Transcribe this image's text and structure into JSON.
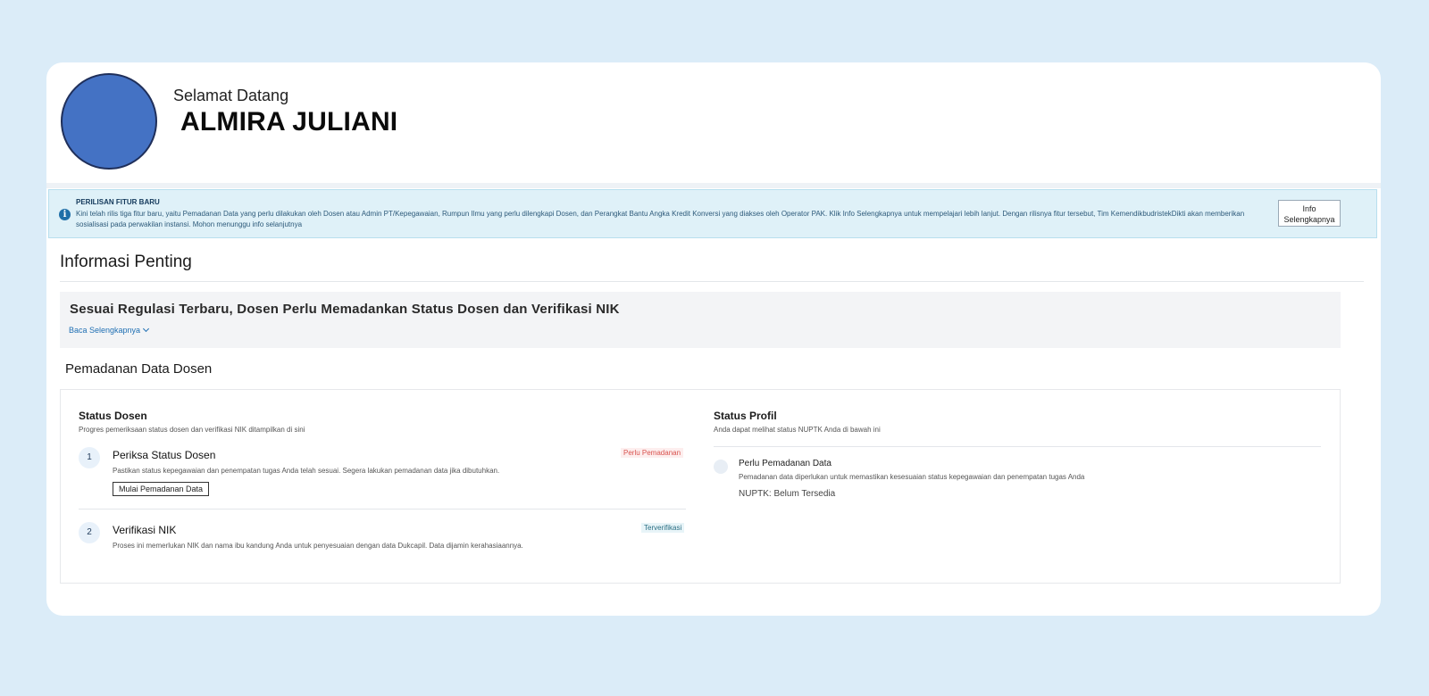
{
  "welcome": {
    "greeting": "Selamat Datang",
    "name": "ALMIRA JULIANI"
  },
  "notice": {
    "title": "PERILISAN FITUR BARU",
    "body": "Kini telah rilis tiga fitur baru, yaitu Pemadanan Data yang perlu dilakukan oleh Dosen atau Admin PT/Kepegawaian, Rumpun Ilmu yang perlu dilengkapi Dosen, dan Perangkat Bantu Angka Kredit Konversi yang diakses oleh Operator PAK. Klik Info Selengkapnya untuk mempelajari lebih lanjut. Dengan rilisnya fitur tersebut, Tim KemendikbudristekDikti akan memberikan sosialisasi pada perwakilan instansi. Mohon menunggu info selanjutnya",
    "button_label": "Info Selengkapnya"
  },
  "important": {
    "title": "Informasi Penting",
    "regulation_title": "Sesuai Regulasi Terbaru, Dosen Perlu Memadankan Status Dosen dan Verifikasi NIK",
    "read_more": "Baca Selengkapnya"
  },
  "matching": {
    "title": "Pemadanan Data Dosen",
    "status_dosen": {
      "title": "Status Dosen",
      "desc": "Progres pemeriksaan status dosen dan verifikasi NIK ditampilkan di sini",
      "steps": [
        {
          "num": "1",
          "title": "Periksa Status Dosen",
          "desc": "Pastikan status kepegawaian dan penempatan tugas Anda telah sesuai. Segera lakukan pemadanan data jika dibutuhkan.",
          "badge": "Perlu Pemadanan",
          "button": "Mulai Pemadanan Data"
        },
        {
          "num": "2",
          "title": "Verifikasi NIK",
          "desc": "Proses ini memerlukan NIK dan nama ibu kandung Anda untuk penyesuaian dengan data Dukcapil. Data dijamin kerahasiaannya.",
          "badge": "Terverifikasi"
        }
      ]
    },
    "status_profil": {
      "title": "Status Profil",
      "desc": "Anda dapat melihat status NUPTK Anda di bawah ini",
      "item_title": "Perlu Pemadanan Data",
      "item_desc": "Pemadanan data diperlukan untuk memastikan kesesuaian status kepegawaian dan penempatan tugas Anda",
      "nuptk": "NUPTK: Belum Tersedia"
    }
  },
  "colors": {
    "background": "#dbecf8",
    "avatar": "#4472c4",
    "notice_bg": "#dff1f8",
    "link": "#1f6fb3",
    "warn": "#d9534f"
  }
}
